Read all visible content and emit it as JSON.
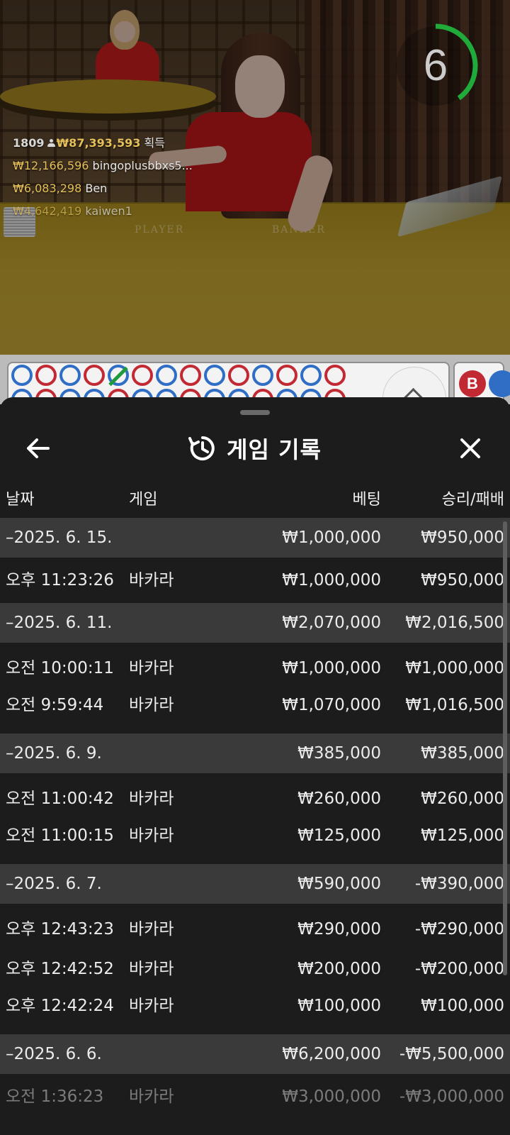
{
  "video": {
    "table_player_label": "PLAYER",
    "table_banker_label": "BANKER",
    "timer_value": "6",
    "timer_fraction": 0.4,
    "winners": {
      "count": "1809",
      "total": "₩87,393,593",
      "total_suffix": "획득",
      "list": [
        {
          "amount": "₩12,166,596",
          "name": "bingoplusbbxs5..."
        },
        {
          "amount": "₩6,083,298",
          "name": "Ben"
        },
        {
          "amount": "₩4,642,419",
          "name": "kaiwen1"
        }
      ]
    }
  },
  "roads": {
    "top_row": [
      "b",
      "r",
      "b",
      "r",
      "b-tie",
      "r",
      "b",
      "r",
      "b",
      "r",
      "b",
      "r",
      "b",
      "r"
    ],
    "banker_badge": "B"
  },
  "history": {
    "title": "게임 기록",
    "columns": {
      "date": "날짜",
      "game": "게임",
      "bet": "베팅",
      "result": "승리/패배"
    },
    "groups": [
      {
        "date": "–2025. 6. 15.",
        "bet": "₩1,000,000",
        "result": "₩950,000",
        "items": [
          {
            "time": "오후 11:23:26",
            "game": "바카라",
            "bet": "₩1,000,000",
            "result": "₩950,000"
          }
        ]
      },
      {
        "date": "–2025. 6. 11.",
        "bet": "₩2,070,000",
        "result": "₩2,016,500",
        "items": [
          {
            "time": "오전 10:00:11",
            "game": "바카라",
            "bet": "₩1,000,000",
            "result": "₩1,000,000"
          },
          {
            "time": "오전 9:59:44",
            "game": "바카라",
            "bet": "₩1,070,000",
            "result": "₩1,016,500"
          }
        ]
      },
      {
        "date": "–2025. 6. 9.",
        "bet": "₩385,000",
        "result": "₩385,000",
        "items": [
          {
            "time": "오전 11:00:42",
            "game": "바카라",
            "bet": "₩260,000",
            "result": "₩260,000"
          },
          {
            "time": "오전 11:00:15",
            "game": "바카라",
            "bet": "₩125,000",
            "result": "₩125,000"
          }
        ]
      },
      {
        "date": "–2025. 6. 7.",
        "bet": "₩590,000",
        "result": "-₩390,000",
        "items": [
          {
            "time": "오후 12:43:23",
            "game": "바카라",
            "bet": "₩290,000",
            "result": "-₩290,000"
          },
          {
            "time": "오후 12:42:52",
            "game": "바카라",
            "bet": "₩200,000",
            "result": "-₩200,000"
          },
          {
            "time": "오후 12:42:24",
            "game": "바카라",
            "bet": "₩100,000",
            "result": "₩100,000"
          }
        ]
      },
      {
        "date": "–2025. 6. 6.",
        "bet": "₩6,200,000",
        "result": "-₩5,500,000",
        "items": [
          {
            "time": "오전 1:36:23",
            "game": "바카라",
            "bet": "₩3,000,000",
            "result": "-₩3,000,000"
          }
        ]
      }
    ]
  }
}
